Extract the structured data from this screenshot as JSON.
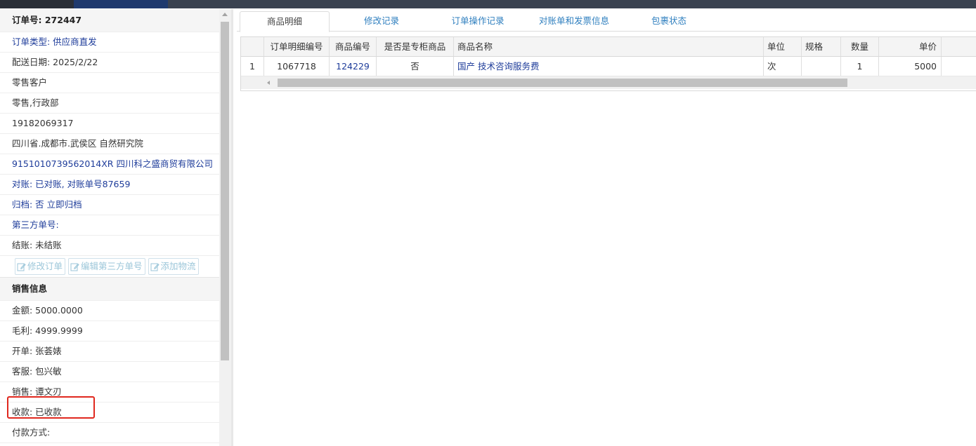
{
  "order": {
    "number_label": "订单号:",
    "number_value": "272447",
    "rows": [
      {
        "text": "订单类型: 供应商直发",
        "blue": true
      },
      {
        "text": "配送日期: 2025/2/22",
        "blue": false
      },
      {
        "text": "零售客户",
        "blue": false
      },
      {
        "text": "零售,行政部",
        "blue": false
      },
      {
        "text": "19182069317",
        "blue": false
      },
      {
        "text": "四川省.成都市.武侯区 自然研究院",
        "blue": false
      },
      {
        "text": "9151010739562014XR 四川科之盛商贸有限公司",
        "blue": true
      },
      {
        "text": "对账: 已对账, 对账单号87659",
        "blue": true
      },
      {
        "text": "归档: 否 立即归档",
        "blue": true
      },
      {
        "text": "第三方单号:",
        "blue": true
      },
      {
        "text": "结账: 未结账",
        "blue": false
      }
    ],
    "buttons": {
      "edit_order": "修改订单",
      "edit_third_party": "编辑第三方单号",
      "add_logistics": "添加物流"
    }
  },
  "sales": {
    "title": "销售信息",
    "rows": [
      "金额: 5000.0000",
      "毛利: 4999.9999",
      "开单: 张荟婊",
      "客服: 包兴敏",
      "销售: 谭文刃",
      "收款: 已收款",
      "付款方式:"
    ]
  },
  "tabs": [
    "商品明细",
    "修改记录",
    "订单操作记录",
    "对账单和发票信息",
    "包裹状态"
  ],
  "grid": {
    "headers": [
      "",
      "订单明细编号",
      "商品编号",
      "是否是专柜商品",
      "商品名称",
      "单位",
      "规格",
      "数量",
      "单价"
    ],
    "rows": [
      [
        "1",
        "1067718",
        "124229",
        "否",
        "国产 技术咨询服务费",
        "次",
        "",
        "1",
        "5000"
      ]
    ]
  }
}
